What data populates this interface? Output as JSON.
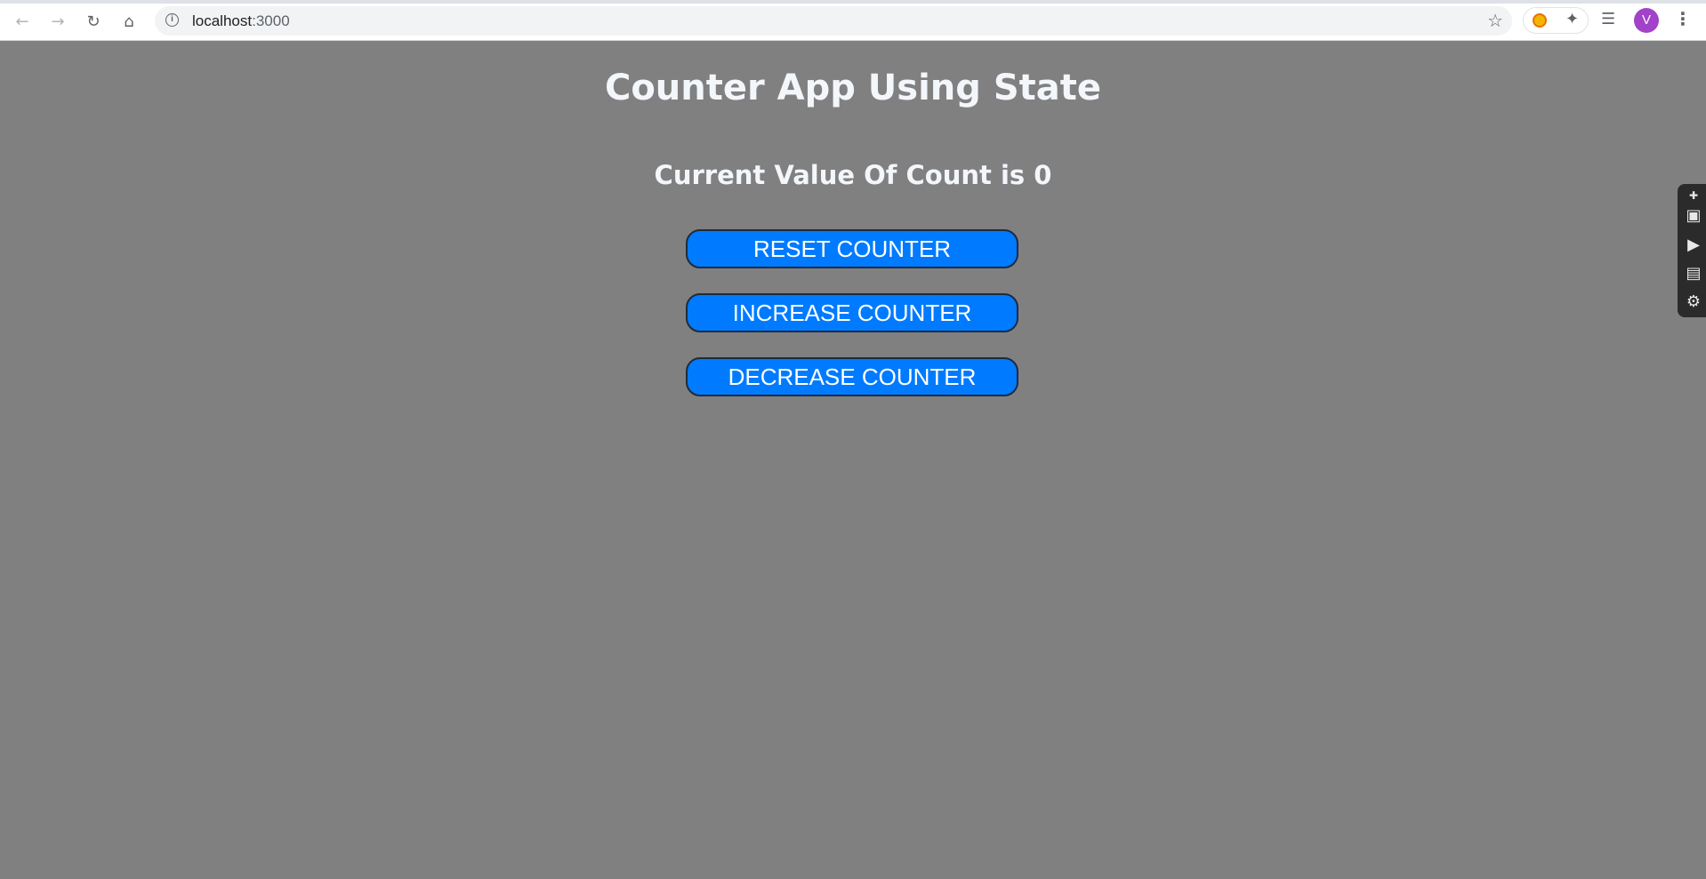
{
  "browser": {
    "url_host": "localhost",
    "url_port": ":3000",
    "avatar_letter": "V",
    "icons": [
      "back-icon",
      "forward-icon",
      "reload-icon",
      "home-icon",
      "info-icon",
      "star-icon",
      "extension-coin-icon",
      "puzzle-icon",
      "media-control-icon",
      "menu-icon"
    ]
  },
  "page": {
    "title": "Counter App Using State",
    "count_text": "Current Value Of Count is 0",
    "buttons": {
      "reset": "RESET COUNTER",
      "increase": "INCREASE COUNTER",
      "decrease": "DECREASE COUNTER"
    }
  },
  "side_toolbar": {
    "icons": [
      "pin-icon",
      "camera-icon",
      "video-icon",
      "gallery-icon",
      "settings-icon"
    ]
  },
  "colors": {
    "page_background": "#808080",
    "button_background": "#007bff",
    "heading_text": "#f3f6fa"
  }
}
